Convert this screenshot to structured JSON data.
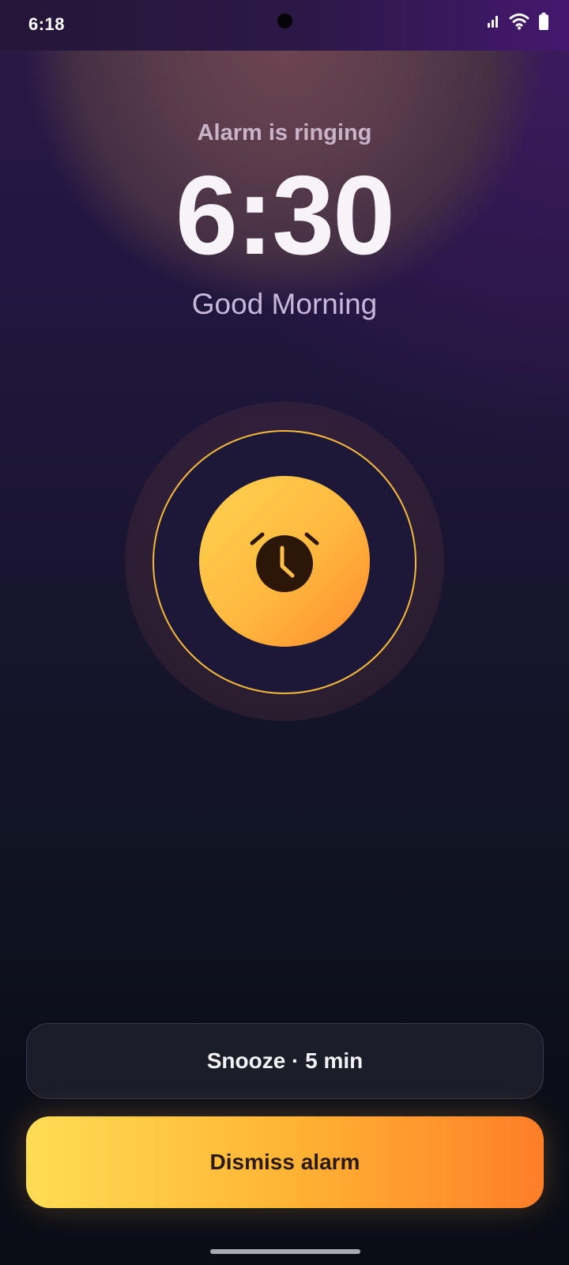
{
  "status_bar": {
    "time": "6:18",
    "icons": [
      "signal-icon",
      "wifi-icon",
      "battery-icon"
    ]
  },
  "alarm": {
    "status_label": "Alarm is ringing",
    "time": "6:30",
    "greeting": "Good Morning",
    "icon": "alarm-clock-icon"
  },
  "actions": {
    "snooze_label": "Snooze · 5 min",
    "dismiss_label": "Dismiss alarm"
  },
  "colors": {
    "accent": "#ffb83f",
    "accent_end": "#ff8a2c",
    "ring": "#f5b93c",
    "background_top": "#2a1848",
    "background_bottom": "#0a0c16"
  }
}
